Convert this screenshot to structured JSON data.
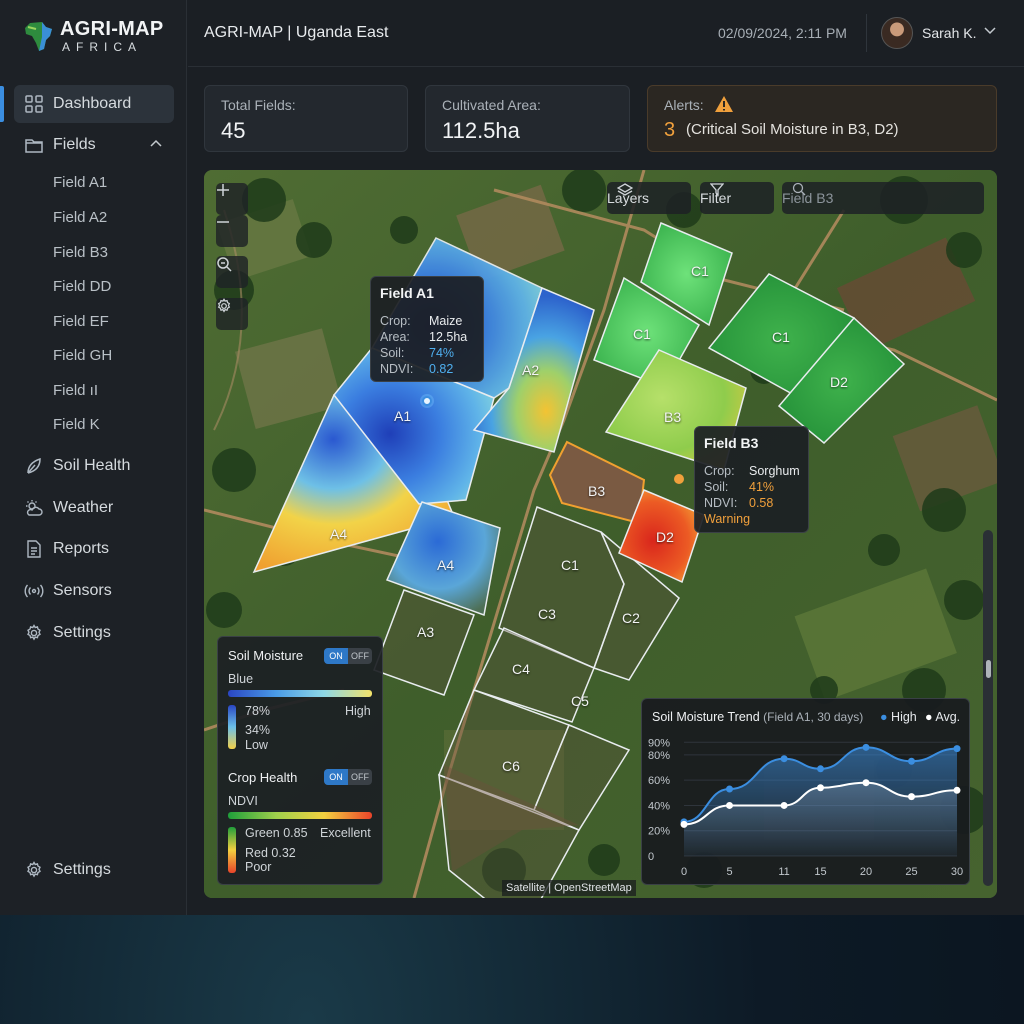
{
  "brand": {
    "title": "AGRI-MAP",
    "subtitle": "AFRICA"
  },
  "sidebar": {
    "items": [
      {
        "label": "Dashboard",
        "icon": "dashboard-icon"
      },
      {
        "label": "Fields",
        "icon": "folder-icon"
      },
      {
        "label": "Soil Health",
        "icon": "soil-health-icon"
      },
      {
        "label": "Weather",
        "icon": "weather-icon"
      },
      {
        "label": "Reports",
        "icon": "report-icon"
      },
      {
        "label": "Sensors",
        "icon": "sensors-icon"
      },
      {
        "label": "Settings",
        "icon": "gear-icon"
      }
    ],
    "fields": [
      "Field A1",
      "Field A2",
      "Field B3",
      "Field DD",
      "Field EF",
      "Field GH",
      "Field ıI",
      "Field K"
    ],
    "bottom_settings": "Settings"
  },
  "header": {
    "title": "AGRI-MAP | Uganda East",
    "datetime": "02/09/2024, 2:11 PM",
    "user": "Sarah K."
  },
  "stats": {
    "total_fields_label": "Total Fields:",
    "total_fields": "45",
    "cultivated_label": "Cultivated Area:",
    "cultivated": "112.5ha",
    "alerts_label": "Alerts:",
    "alerts_count": "3",
    "alerts_text": "(Critical Soil Moisture in B3, D2)",
    "accent": "#f0a03c"
  },
  "map": {
    "layers_label": "Layers",
    "filter_label": "Filter",
    "search_placeholder": "Field B3",
    "attribution": "Satellite | OpenStreetMap",
    "fields": [
      "A1",
      "A2",
      "A4",
      "A4",
      "A3",
      "C1",
      "C1",
      "C1",
      "D2",
      "B3",
      "B3",
      "D2",
      "C1",
      "C2",
      "C3",
      "C4",
      "C5",
      "C6"
    ],
    "tooltip_a1": {
      "title": "Field A1",
      "rows": [
        {
          "label": "Crop:",
          "value": "Maize"
        },
        {
          "label": "Area:",
          "value": "12.5ha"
        },
        {
          "label": "Soil:",
          "value": "74%"
        },
        {
          "label": "NDVI:",
          "value": "0.82"
        }
      ]
    },
    "tooltip_b3": {
      "title": "Field B3",
      "rows": [
        {
          "label": "Crop:",
          "value": "Sorghum"
        },
        {
          "label": "Soil:",
          "value": "41%"
        },
        {
          "label": "NDVI:",
          "value": "0.58"
        }
      ],
      "status": "Warning"
    }
  },
  "legend": {
    "soil_title": "Soil Moisture",
    "toggle_on": "ON",
    "toggle_off": "OFF",
    "soil_scale": "Blue",
    "soil_high": "High",
    "soil_v1": "78%",
    "soil_v2": "34%",
    "soil_low": "Low",
    "crop_title": "Crop Health",
    "crop_scale": "NDVI",
    "crop_green": "Green 0.85",
    "crop_excellent": "Excellent",
    "crop_red": "Red 0.32",
    "crop_poor": "Poor"
  },
  "chart_title": "Soil Moisture Trend",
  "chart_subtitle": "(Field A1, 30 days)",
  "chart_data": {
    "type": "area",
    "x": [
      0,
      5,
      11,
      15,
      20,
      25,
      30
    ],
    "series": [
      {
        "name": "High",
        "values": [
          27,
          53,
          77,
          69,
          86,
          75,
          85
        ],
        "color": "#3b8ee0"
      },
      {
        "name": "Avg.",
        "values": [
          25,
          40,
          40,
          54,
          58,
          47,
          52
        ],
        "color": "#ffffff"
      }
    ],
    "yticks": [
      "0",
      "20%",
      "40%",
      "60%",
      "80%",
      "90%"
    ],
    "xticks": [
      "0",
      "5",
      "11",
      "15",
      "20",
      "25",
      "30"
    ],
    "ylim": [
      0,
      100
    ],
    "grid": true,
    "legend": "top-right"
  }
}
